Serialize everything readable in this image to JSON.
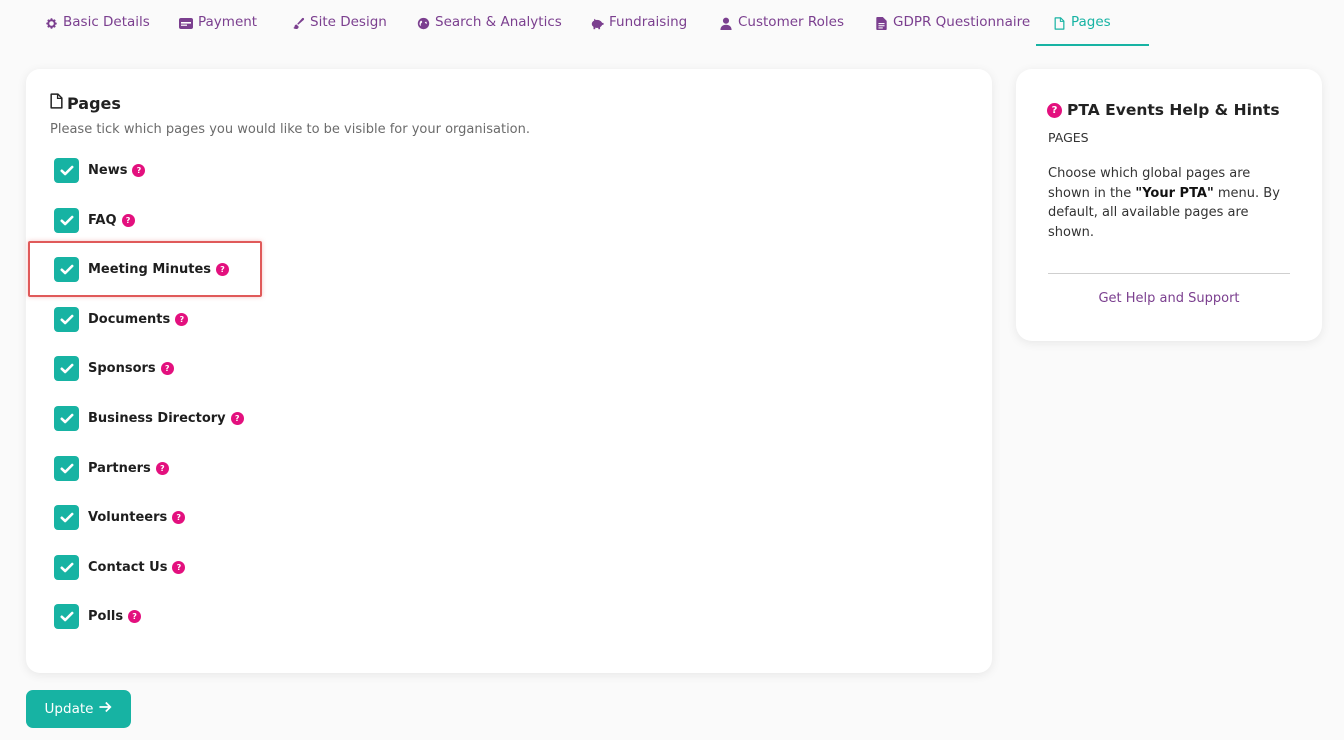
{
  "tabs": [
    {
      "label": "Basic Details",
      "icon": "gear-icon"
    },
    {
      "label": "Payment",
      "icon": "stripe-icon"
    },
    {
      "label": "Site Design",
      "icon": "paint-brush-icon"
    },
    {
      "label": "Search & Analytics",
      "icon": "globe-icon"
    },
    {
      "label": "Fundraising",
      "icon": "piggy-bank-icon"
    },
    {
      "label": "Customer Roles",
      "icon": "user-icon"
    },
    {
      "label": "GDPR Questionnaire",
      "icon": "document-icon"
    },
    {
      "label": "Pages",
      "icon": "file-icon",
      "active": true
    }
  ],
  "card": {
    "title": "Pages",
    "subtitle": "Please tick which pages you would like to be visible for your organisation."
  },
  "pages": [
    {
      "label": "News",
      "checked": true
    },
    {
      "label": "FAQ",
      "checked": true
    },
    {
      "label": "Meeting Minutes",
      "checked": true,
      "highlighted": true
    },
    {
      "label": "Documents",
      "checked": true
    },
    {
      "label": "Sponsors",
      "checked": true
    },
    {
      "label": "Business Directory",
      "checked": true
    },
    {
      "label": "Partners",
      "checked": true
    },
    {
      "label": "Volunteers",
      "checked": true
    },
    {
      "label": "Contact Us",
      "checked": true
    },
    {
      "label": "Polls",
      "checked": true
    }
  ],
  "update_button": {
    "label": "Update"
  },
  "help": {
    "title": "PTA Events Help & Hints",
    "section": "PAGES",
    "text_before": "Choose which global pages are shown in the ",
    "text_bold": "\"Your PTA\"",
    "text_after": " menu. By default, all available pages are shown.",
    "link": "Get Help and Support"
  },
  "colors": {
    "accent": "#17b3a3",
    "brand_purple": "#7b3f8f",
    "help_pink": "#e3107e",
    "highlight_red": "#e05a5a"
  }
}
